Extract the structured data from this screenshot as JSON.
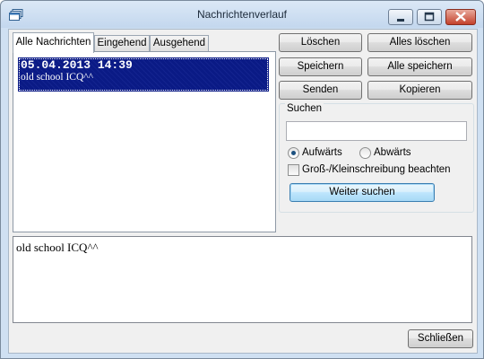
{
  "window": {
    "title": "Nachrichtenverlauf",
    "minimize_icon": "minimize-icon",
    "maximize_icon": "maximize-icon",
    "close_icon": "close-icon"
  },
  "tabs": [
    {
      "label": "Alle Nachrichten",
      "active": true
    },
    {
      "label": "Eingehend",
      "active": false
    },
    {
      "label": "Ausgehend",
      "active": false
    }
  ],
  "messages": [
    {
      "date": "05.04.2013 14:39",
      "preview": "old school ICQ^^",
      "selected": true
    }
  ],
  "actions": {
    "delete": "Löschen",
    "delete_all": "Alles löschen",
    "save": "Speichern",
    "save_all": "Alle speichern",
    "send": "Senden",
    "copy": "Kopieren"
  },
  "search": {
    "group_label": "Suchen",
    "value": "",
    "placeholder": "",
    "direction_up": "Aufwärts",
    "direction_down": "Abwärts",
    "direction_selected": "up",
    "case_sensitive_label": "Groß-/Kleinschreibung beachten",
    "case_sensitive": false,
    "find_next": "Weiter suchen"
  },
  "detail_text": "old school ICQ^^",
  "close_button": "Schließen",
  "colors": {
    "selection": "#0a1a85",
    "titlebar": "#c3d7ee",
    "close_button": "#c3412b"
  }
}
